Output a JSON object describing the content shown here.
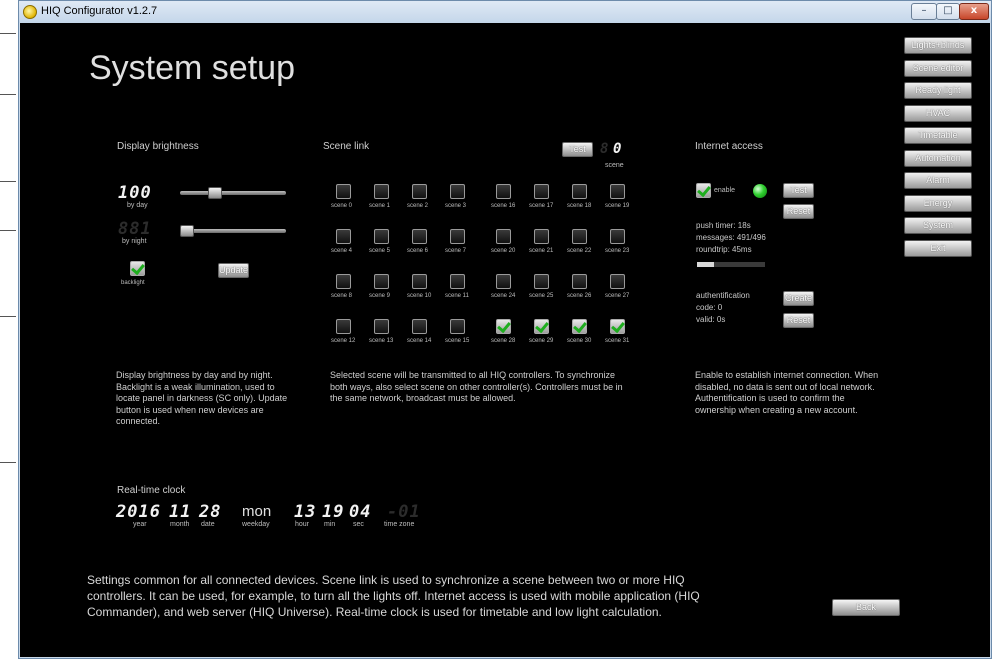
{
  "window": {
    "title": "HIQ Configurator v1.2.7",
    "min": "–",
    "max": "□",
    "close": "x"
  },
  "page_title": "System setup",
  "nav": [
    "Lights+blinds",
    "Scene editor",
    "Ready light",
    "HVAC",
    "Timetable",
    "Automation",
    "Alarm",
    "Energy",
    "System",
    "Exit"
  ],
  "brightness": {
    "title": "Display brightness",
    "day_value": "100",
    "day_label": "by day",
    "day_level_pct": 30,
    "night_value": "881",
    "night_label": "by night",
    "night_level_pct": 0,
    "backlight_label": "backlight",
    "backlight_checked": true,
    "update_label": "Update",
    "desc": "Display brightness by day and by night. Backlight is a weak illumination, used to locate panel in darkness (SC only). Update button is used when new devices are connected."
  },
  "scene_link": {
    "title": "Scene link",
    "test_label": "Test",
    "scene_value": "0",
    "scene_label": "scene",
    "left_scenes": [
      [
        "scene 0",
        "scene 1",
        "scene 2",
        "scene 3"
      ],
      [
        "scene 4",
        "scene 5",
        "scene 6",
        "scene 7"
      ],
      [
        "scene 8",
        "scene 9",
        "scene 10",
        "scene 11"
      ],
      [
        "scene 12",
        "scene 13",
        "scene 14",
        "scene 15"
      ]
    ],
    "right_scenes": [
      [
        "scene 16",
        "scene 17",
        "scene 18",
        "scene 19"
      ],
      [
        "scene 20",
        "scene 21",
        "scene 22",
        "scene 23"
      ],
      [
        "scene 24",
        "scene 25",
        "scene 26",
        "scene 27"
      ],
      [
        "scene 28",
        "scene 29",
        "scene 30",
        "scene 31"
      ]
    ],
    "checked": [
      "scene 28",
      "scene 29",
      "scene 30",
      "scene 31"
    ],
    "desc": "Selected scene will be transmitted to all HIQ controllers. To synchronize both ways, also select scene on other controller(s). Controllers must be in the same network, broadcast must be allowed."
  },
  "internet": {
    "title": "Internet access",
    "enable_label": "enable",
    "enable_checked": true,
    "test_label": "Test",
    "reset_label": "Reset",
    "push_timer": "push timer: 18s",
    "messages": "messages: 491/496",
    "roundtrip": "roundtrip: 45ms",
    "progress_pct": 25,
    "auth_label": "authentification",
    "code": "code: 0",
    "valid": "valid: 0s",
    "create_label": "Create",
    "reset2_label": "Reset",
    "desc": "Enable to establish internet connection. When disabled, no data is sent out of local network. Authentification is used to confirm the ownership when creating a new account."
  },
  "clock": {
    "title": "Real-time clock",
    "year": "2016",
    "year_label": "year",
    "month": "11",
    "month_label": "month",
    "date": "28",
    "date_label": "date",
    "weekday": "mon",
    "weekday_label": "weekday",
    "hour": "13",
    "hour_label": "hour",
    "min": "19",
    "min_label": "min",
    "sec": "04",
    "sec_label": "sec",
    "tz": "-01",
    "tz_label": "time zone"
  },
  "bottom_desc": "Settings common for all connected devices. Scene link is used to synchronize a scene between two or more HIQ controllers. It can be used, for example, to turn all the lights off. Internet access is used with mobile application (HIQ Commander), and web server (HIQ Universe). Real-time clock is used for timetable and low light calculation.",
  "back_label": "Back",
  "colors": {
    "background": "#000000",
    "check_green": "#1fae1f",
    "led_green": "#30d030",
    "titlebar": "#c4d6ea"
  }
}
